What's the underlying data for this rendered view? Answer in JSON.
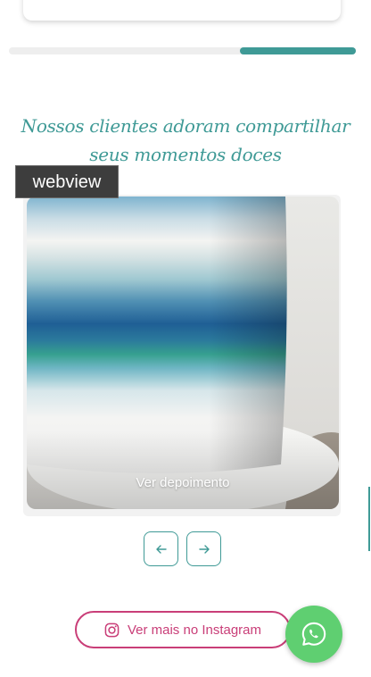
{
  "carousel": {
    "progress_fraction": 0.33,
    "heading": "Nossos clientes adoram compartilhar seus momentos doces",
    "slide": {
      "link_label": "Ver depoimento",
      "image": "cake-photo"
    },
    "prev_icon": "arrow-left-icon",
    "next_icon": "arrow-right-icon"
  },
  "overlay_badge": "webview",
  "instagram": {
    "label": "Ver mais no Instagram",
    "icon": "instagram-icon"
  },
  "whatsapp": {
    "icon": "whatsapp-icon"
  },
  "colors": {
    "accent": "#3f9a96",
    "instagram": "#c93e78",
    "whatsapp": "#5fcf71"
  }
}
